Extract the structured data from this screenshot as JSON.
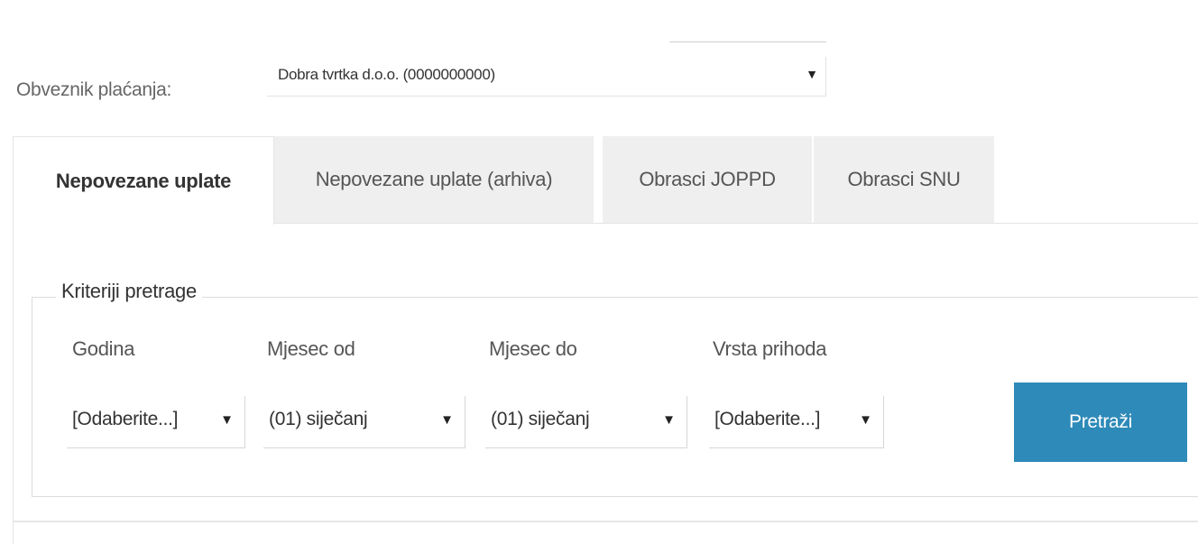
{
  "payer": {
    "label": "Obveznik plaćanja:",
    "selected": "Dobra tvrtka d.o.o. (0000000000)",
    "arrow_icon": "▼"
  },
  "tabs": [
    {
      "label": "Nepovezane uplate",
      "active": true
    },
    {
      "label": "Nepovezane uplate (arhiva)",
      "active": false
    },
    {
      "label": "Obrasci JOPPD",
      "active": false
    },
    {
      "label": "Obrasci SNU",
      "active": false
    }
  ],
  "search": {
    "legend": "Kriteriji pretrage",
    "fields": [
      {
        "label": "Godina",
        "value": "[Odaberite...]"
      },
      {
        "label": "Mjesec od",
        "value": "(01) siječanj"
      },
      {
        "label": "Mjesec do",
        "value": "(01) siječanj"
      },
      {
        "label": "Vrsta prihoda",
        "value": "[Odaberite...]"
      }
    ],
    "arrow_icon": "▼",
    "button_label": "Pretraži"
  },
  "colors": {
    "button": "#2e8ab8",
    "inactive_tab": "#efefef"
  }
}
